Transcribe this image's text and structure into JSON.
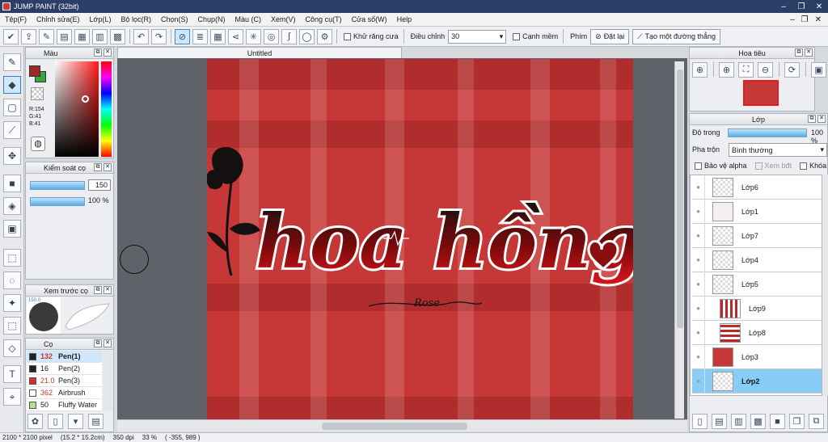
{
  "window": {
    "title": "JUMP PAINT (32bit)",
    "controls": [
      "–",
      "❐",
      "✕"
    ]
  },
  "menu": [
    "Tệp(F)",
    "Chỉnh sửa(E)",
    "Lớp(L)",
    "Bộ lọc(R)",
    "Chọn(S)",
    "Chụp(N)",
    "Màu (C)",
    "Xem(V)",
    "Công cụ(T)",
    "Cửa sổ(W)",
    "Help"
  ],
  "toolbar": {
    "antialias_label": "Khử răng cưa",
    "adjust_label": "Điều chỉnh",
    "adjust_value": "30",
    "soft_edge_label": "Cạnh mềm",
    "key_label": "Phím",
    "reset_label": "Đặt lại",
    "straight_line_label": "Tạo một đường thẳng"
  },
  "color_panel": {
    "title": "Màu",
    "r": "R:154",
    "g": "G:41",
    "b": "B:41",
    "fg": "#9a2929",
    "bg": "#3aa53a"
  },
  "brush_control": {
    "title": "Kiểm soát cọ",
    "size": "150",
    "opacity": "100 %"
  },
  "brush_preview": {
    "title": "Xem trước cọ",
    "size_text": "150.0"
  },
  "pens_panel": {
    "title": "Cọ",
    "pens": [
      {
        "size": "132",
        "name": "Pen(1)",
        "color": "#222222",
        "selected": true
      },
      {
        "size": "16",
        "name": "Pen(2)",
        "color": "#222222",
        "selected": false
      },
      {
        "size": "21.0",
        "name": "Pen(3)",
        "color": "#d32f2f",
        "selected": false
      },
      {
        "size": "362",
        "name": "Airbrush",
        "color": "#ffffff",
        "selected": false
      },
      {
        "size": "50",
        "name": "Fluffy Water",
        "color": "#b5e08a",
        "selected": false
      }
    ]
  },
  "document": {
    "tab": "Untitled"
  },
  "artwork": {
    "main_text": "hoa hồng",
    "sub_text": "Rose"
  },
  "navigator": {
    "title": "Hoa tiêu"
  },
  "layers_panel": {
    "title": "Lớp",
    "opacity_label": "Độ trong",
    "opacity_value": "100 %",
    "blend_label": "Pha trộn",
    "blend_value": "Bình thường",
    "protect_alpha": "Bảo vệ alpha",
    "draft": "Xem bđt",
    "lock": "Khóa",
    "layers": [
      {
        "name": "Lớp6",
        "thumb": "blank"
      },
      {
        "name": "Lớp1",
        "thumb": "text"
      },
      {
        "name": "Lớp7",
        "thumb": "blank"
      },
      {
        "name": "Lớp4",
        "thumb": "blank"
      },
      {
        "name": "Lớp5",
        "thumb": "blank"
      },
      {
        "name": "Lớp9",
        "thumb": "vstripes"
      },
      {
        "name": "Lớp8",
        "thumb": "hstripes"
      },
      {
        "name": "Lớp3",
        "thumb": "red"
      },
      {
        "name": "Lớp2",
        "thumb": "blank",
        "selected": true
      }
    ]
  },
  "status": {
    "size": "2100 * 2100 pixel",
    "physical": "(15.2 * 15.2cm)",
    "dpi": "350 dpi",
    "zoom": "33 %",
    "coords": "( -355, 989 )"
  }
}
